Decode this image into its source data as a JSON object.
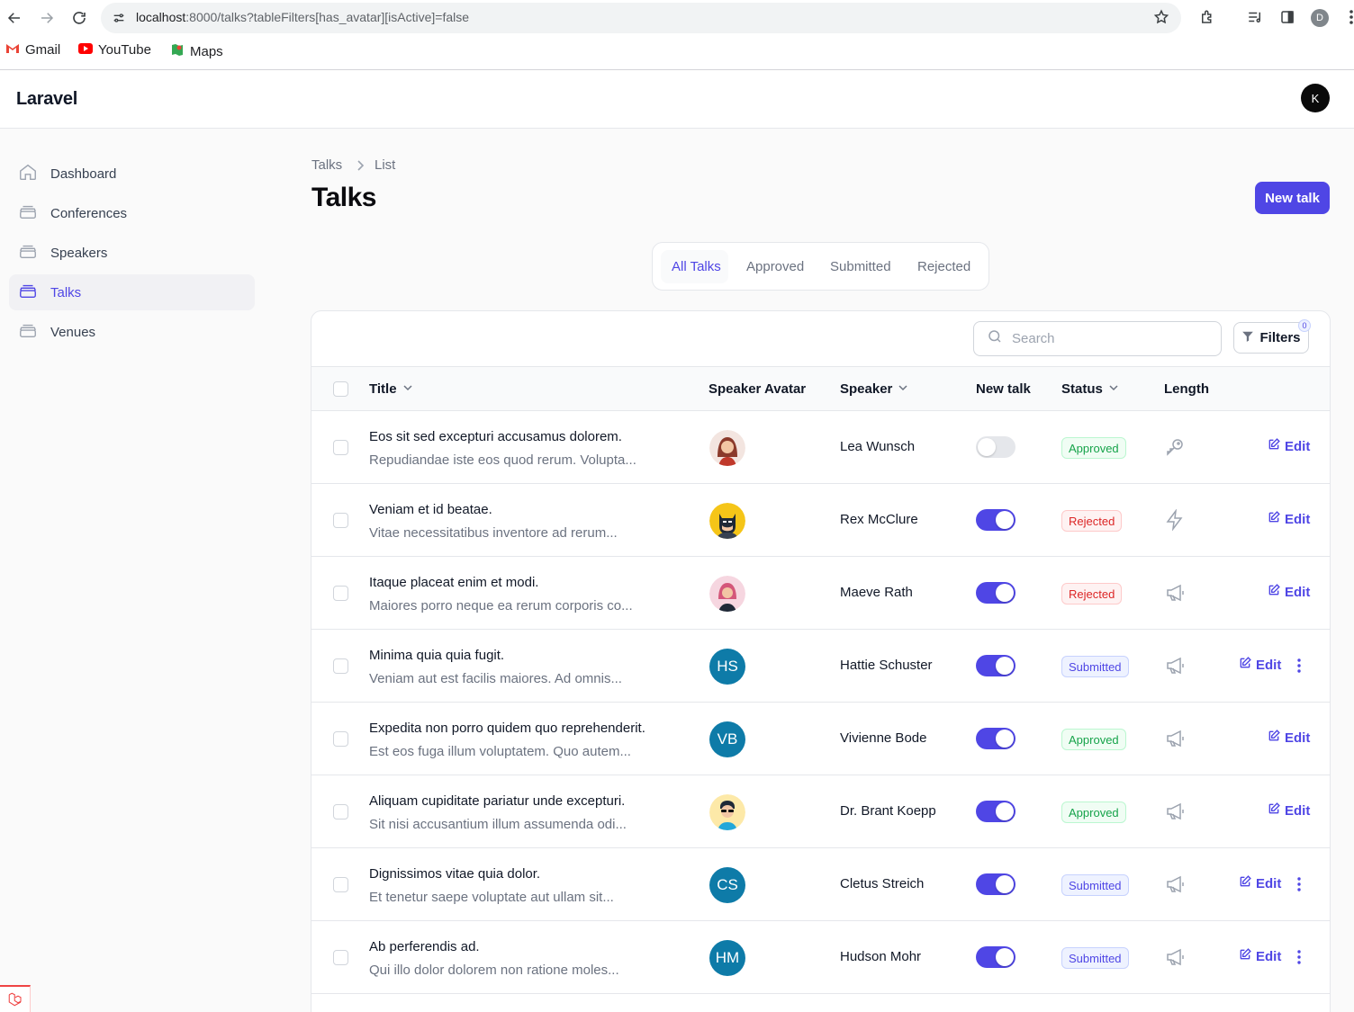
{
  "browser": {
    "url_host": "localhost",
    "url_rest": ":8000/talks?tableFilters[has_avatar][isActive]=false",
    "profile_initial": "D",
    "bookmarks": [
      {
        "label": "Gmail",
        "icon": "gmail-icon"
      },
      {
        "label": "YouTube",
        "icon": "youtube-icon"
      },
      {
        "label": "Maps",
        "icon": "maps-icon"
      }
    ]
  },
  "header": {
    "brand": "Laravel",
    "user_initial": "K"
  },
  "sidebar": {
    "items": [
      {
        "label": "Dashboard",
        "icon": "home-icon"
      },
      {
        "label": "Conferences",
        "icon": "stack-icon"
      },
      {
        "label": "Speakers",
        "icon": "stack-icon"
      },
      {
        "label": "Talks",
        "icon": "stack-icon",
        "active": true
      },
      {
        "label": "Venues",
        "icon": "stack-icon"
      }
    ]
  },
  "breadcrumb": {
    "parent": "Talks",
    "current": "List"
  },
  "page": {
    "title": "Talks",
    "new_button": "New talk"
  },
  "tabs": [
    "All Talks",
    "Approved",
    "Submitted",
    "Rejected"
  ],
  "table": {
    "search_placeholder": "Search",
    "filters_label": "Filters",
    "filters_count": "0",
    "columns": {
      "title": "Title",
      "avatar": "Speaker Avatar",
      "speaker": "Speaker",
      "new_talk": "New talk",
      "status": "Status",
      "length": "Length"
    },
    "edit_label": "Edit",
    "rows": [
      {
        "title": "Eos sit sed excepturi accusamus dolorem.",
        "abstract": "Repudiandae iste eos quod rerum. Volupta...",
        "avatar": "avatar-woman-brown-hair",
        "initials": "",
        "speaker": "Lea Wunsch",
        "new_talk": false,
        "status": "Approved",
        "length_icon": "key-icon",
        "has_more": false
      },
      {
        "title": "Veniam et id beatae.",
        "abstract": "Vitae necessitatibus inventore ad rerum...",
        "avatar": "avatar-batman",
        "initials": "",
        "speaker": "Rex McClure",
        "new_talk": true,
        "status": "Rejected",
        "length_icon": "lightning-icon",
        "has_more": false
      },
      {
        "title": "Itaque placeat enim et modi.",
        "abstract": "Maiores porro neque ea rerum corporis co...",
        "avatar": "avatar-woman-pink",
        "initials": "",
        "speaker": "Maeve Rath",
        "new_talk": true,
        "status": "Rejected",
        "length_icon": "megaphone-icon",
        "has_more": false
      },
      {
        "title": "Minima quia quia fugit.",
        "abstract": "Veniam aut est facilis maiores. Ad omnis...",
        "avatar": "",
        "initials": "HS",
        "speaker": "Hattie Schuster",
        "new_talk": true,
        "status": "Submitted",
        "length_icon": "megaphone-icon",
        "has_more": true
      },
      {
        "title": "Expedita non porro quidem quo reprehenderit.",
        "abstract": "Est eos fuga illum voluptatem. Quo autem...",
        "avatar": "",
        "initials": "VB",
        "speaker": "Vivienne Bode",
        "new_talk": true,
        "status": "Approved",
        "length_icon": "megaphone-icon",
        "has_more": false
      },
      {
        "title": "Aliquam cupiditate pariatur unde excepturi.",
        "abstract": "Sit nisi accusantium illum assumenda odi...",
        "avatar": "avatar-man-sunglasses",
        "initials": "",
        "speaker": "Dr. Brant Koepp",
        "new_talk": true,
        "status": "Approved",
        "length_icon": "megaphone-icon",
        "has_more": false
      },
      {
        "title": "Dignissimos vitae quia dolor.",
        "abstract": "Et tenetur saepe voluptate aut ullam sit...",
        "avatar": "",
        "initials": "CS",
        "speaker": "Cletus Streich",
        "new_talk": true,
        "status": "Submitted",
        "length_icon": "megaphone-icon",
        "has_more": true
      },
      {
        "title": "Ab perferendis ad.",
        "abstract": "Qui illo dolor dolorem non ratione moles...",
        "avatar": "",
        "initials": "HM",
        "speaker": "Hudson Mohr",
        "new_talk": true,
        "status": "Submitted",
        "length_icon": "megaphone-icon",
        "has_more": true
      }
    ]
  },
  "colors": {
    "primary": "#4f46e5",
    "approved": "#16a34a",
    "rejected": "#dc2626",
    "avatar_bg": "#0e7ba8"
  }
}
